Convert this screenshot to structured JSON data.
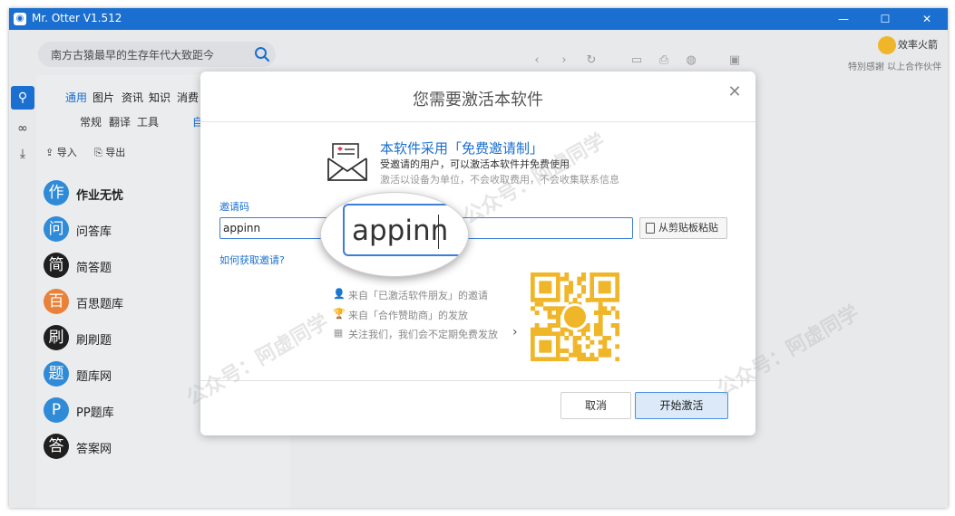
{
  "app": {
    "title": "Mr. Otter V1.512",
    "logo_icon": "otter-logo-icon",
    "window_controls": [
      "—",
      "☐",
      "✕"
    ]
  },
  "search": {
    "query": "南方古猿最早的生存年代大致距今",
    "icon": "search-icon"
  },
  "brand": {
    "name": "效率火箭",
    "tip": "特別感謝 以上合作伙伴"
  },
  "sidebar": {
    "category_tabs": [
      {
        "label": "通用",
        "active": true
      },
      {
        "label": "图片"
      },
      {
        "label": "资讯"
      },
      {
        "label": "知识"
      },
      {
        "label": "消费"
      }
    ],
    "sub_tabs": [
      "常规",
      "翻译",
      "工具",
      "自"
    ],
    "import_label": "导入",
    "export_label": "导出",
    "sources": [
      {
        "badge": "作",
        "label": "作业无忧",
        "color": "#2f8bd8",
        "bold": true
      },
      {
        "badge": "问",
        "label": "问答库",
        "color": "#2f8bd8"
      },
      {
        "badge": "简",
        "label": "简答题",
        "color": "#1f1f1f"
      },
      {
        "badge": "百",
        "label": "百思题库",
        "color": "#e8823a"
      },
      {
        "badge": "刷",
        "label": "刷刷题",
        "color": "#1f1f1f"
      },
      {
        "badge": "题",
        "label": "题库网",
        "color": "#2f8bd8"
      },
      {
        "badge": "P",
        "label": "PP题库",
        "color": "#2f8bd8"
      },
      {
        "badge": "答",
        "label": "答案网",
        "color": "#1f1f1f"
      }
    ]
  },
  "modal": {
    "title": "您需要激活本软件",
    "headline": "本软件采用「免费邀请制」",
    "desc1": "受邀请的用户，可以激活本软件并免费使用",
    "desc2": "激活以设备为单位，不会收取费用，不会收集联系信息",
    "invite_label": "邀请码",
    "invite_value": "appinn",
    "paste_label": "从剪贴板粘贴",
    "howto": "如何获取邀请?",
    "sources": [
      {
        "icon": "👤",
        "text": "来自「已激活软件朋友」的邀请"
      },
      {
        "icon": "🏆",
        "text": "来自「合作赞助商」的发放"
      },
      {
        "icon": "▦",
        "text": "关注我们，我们会不定期免费发放"
      }
    ],
    "cancel_label": "取消",
    "activate_label": "开始激活"
  },
  "watermark": "公众号：阿虚同学",
  "colors": {
    "accent": "#1a6fd0",
    "qr": "#f0b629"
  }
}
